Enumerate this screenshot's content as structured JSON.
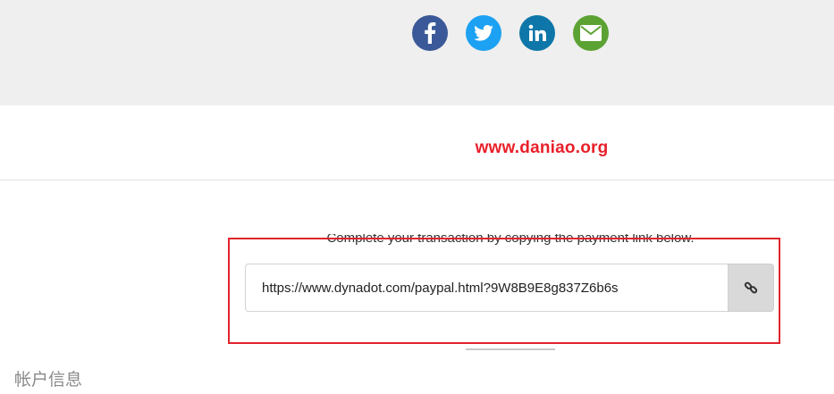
{
  "share": {
    "icons": [
      {
        "name": "facebook-icon",
        "color": "#3b5998"
      },
      {
        "name": "twitter-icon",
        "color": "#1da1f2"
      },
      {
        "name": "linkedin-icon",
        "color": "#0e76a8"
      },
      {
        "name": "email-icon",
        "color": "#5ba233"
      }
    ]
  },
  "watermark": {
    "text": "www.daniao.org",
    "color": "#e8202a"
  },
  "payment": {
    "instruction": "Complete your transaction by copying the payment link below.",
    "link_value": "https://www.dynadot.com/paypal.html?9W8B9E8g837Z6b6s",
    "copy_icon": "link-icon"
  },
  "highlight": {
    "color": "#e0242c"
  },
  "account": {
    "heading": "帐户信息"
  }
}
